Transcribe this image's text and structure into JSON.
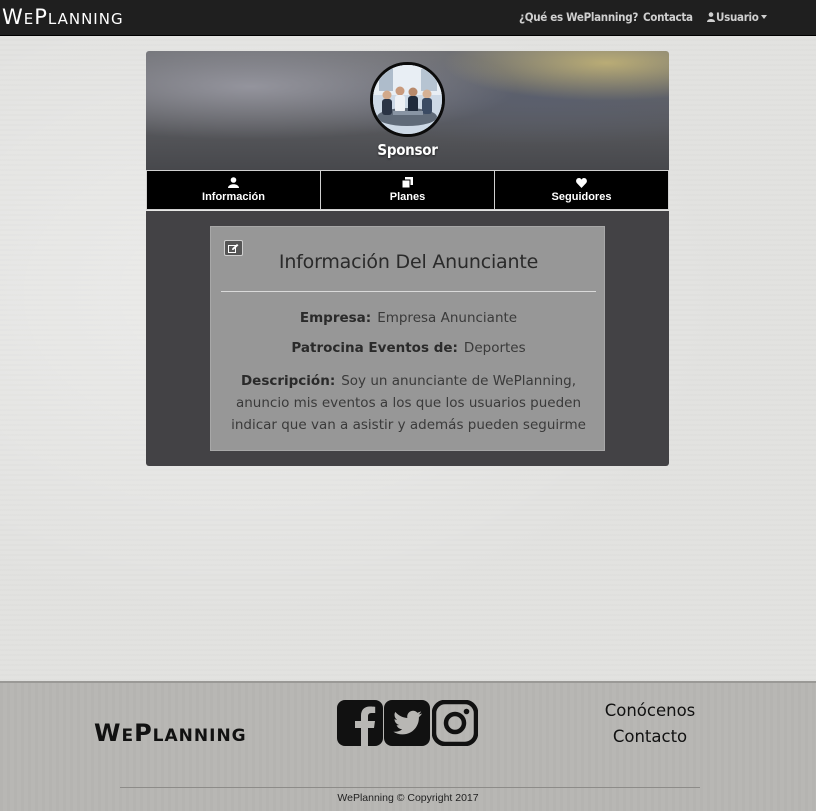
{
  "navbar": {
    "brand": "WePlanning",
    "links": {
      "about": "¿Qué es WePlanning?",
      "contact": "Contacta",
      "user": "Usuario"
    },
    "icons": {
      "user": "user-icon",
      "dropdown": "caret-down-icon"
    }
  },
  "profile": {
    "name": "Sponsor",
    "avatar_icon": "meeting-photo"
  },
  "tabs": [
    {
      "label": "Información",
      "icon": "user-icon"
    },
    {
      "label": "Planes",
      "icon": "copy-icon"
    },
    {
      "label": "Seguidores",
      "icon": "heart-icon"
    }
  ],
  "info_card": {
    "title": "Información Del Anunciante",
    "edit_icon": "edit-icon",
    "fields": {
      "company_label": "Empresa:",
      "company_value": "Empresa Anunciante",
      "sponsors_label": "Patrocina Eventos de:",
      "sponsors_value": "Deportes",
      "description_label": "Descripción:",
      "description_value": "Soy un anunciante de WePlanning, anuncio mis eventos a los que los usuarios pueden indicar que van a asistir y además pueden seguirme"
    }
  },
  "footer": {
    "brand": "WePlanning",
    "social": [
      "facebook-icon",
      "twitter-icon",
      "instagram-icon"
    ],
    "links": {
      "about": "Conócenos",
      "contact": "Contacto"
    },
    "copyright": "WePlanning © Copyright 2017"
  },
  "colors": {
    "navbar_bg": "#1f1f1f",
    "tab_bg": "#000000",
    "panel_bg": "#434245",
    "card_bg": "#979797",
    "footer_bg": "#b8b7b4"
  }
}
